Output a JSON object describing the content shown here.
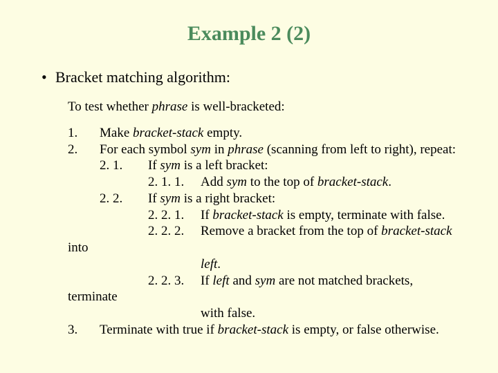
{
  "title": "Example 2 (2)",
  "bullet_text": "Bracket matching algorithm:",
  "intro_a": "To test whether ",
  "intro_b": "phrase",
  "intro_c": " is well-bracketed:",
  "s1_n": "1.",
  "s1_a": "Make ",
  "s1_b": "bracket-stack",
  "s1_c": " empty.",
  "s2_n": "2.",
  "s2_a": "For each symbol ",
  "s2_b": "sym",
  "s2_c": " in ",
  "s2_d": "phrase",
  "s2_e": " (scanning from left to right), repeat:",
  "s21_n": "2. 1.",
  "s21_a": "If ",
  "s21_b": "sym",
  "s21_c": " is a left bracket:",
  "s211_n": "2. 1. 1.",
  "s211_a": "Add ",
  "s211_b": "sym",
  "s211_c": " to the top of ",
  "s211_d": "bracket-stack",
  "s211_e": ".",
  "s22_n": "2. 2.",
  "s22_a": "If ",
  "s22_b": "sym",
  "s22_c": " is a right bracket:",
  "s221_n": "2. 2. 1.",
  "s221_a": "If ",
  "s221_b": "bracket-stack",
  "s221_c": " is empty, terminate with false.",
  "s222_n": "2. 2. 2.",
  "s222_a": "Remove a bracket from the top of ",
  "s222_b": "bracket-stack",
  "into": "into",
  "left_a": "left",
  "left_b": ".",
  "s223_n": "2. 2. 3.",
  "s223_a": "If ",
  "s223_b": "left",
  "s223_c": " and ",
  "s223_d": "sym",
  "s223_e": " are not matched brackets,",
  "terminate": "terminate",
  "withfalse": "with false.",
  "s3_n": "3.",
  "s3_a": "Terminate with true if ",
  "s3_b": "bracket-stack",
  "s3_c": " is empty, or false otherwise."
}
